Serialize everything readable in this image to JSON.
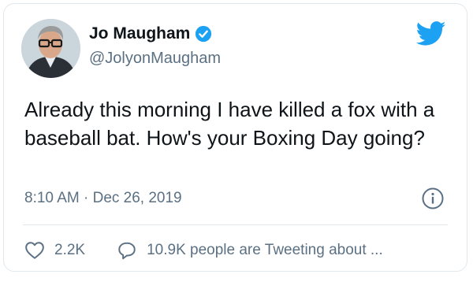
{
  "tweet": {
    "author_name": "Jo Maugham",
    "author_handle": "@JolyonMaugham",
    "text": "Already this morning I have killed a fox with a baseball bat. How's your Boxing Day going?",
    "timestamp": "8:10 AM · Dec 26, 2019",
    "likes": "2.2K",
    "conversation": "10.9K people are Tweeting about ..."
  },
  "icons": {
    "verified": "verified-badge-icon",
    "brand": "twitter-bird-icon",
    "info": "info-icon",
    "like": "heart-icon",
    "reply": "speech-bubble-icon"
  },
  "colors": {
    "brand_blue": "#1DA1F2",
    "secondary_text": "#5b7083",
    "divider": "#e1e8ed"
  }
}
